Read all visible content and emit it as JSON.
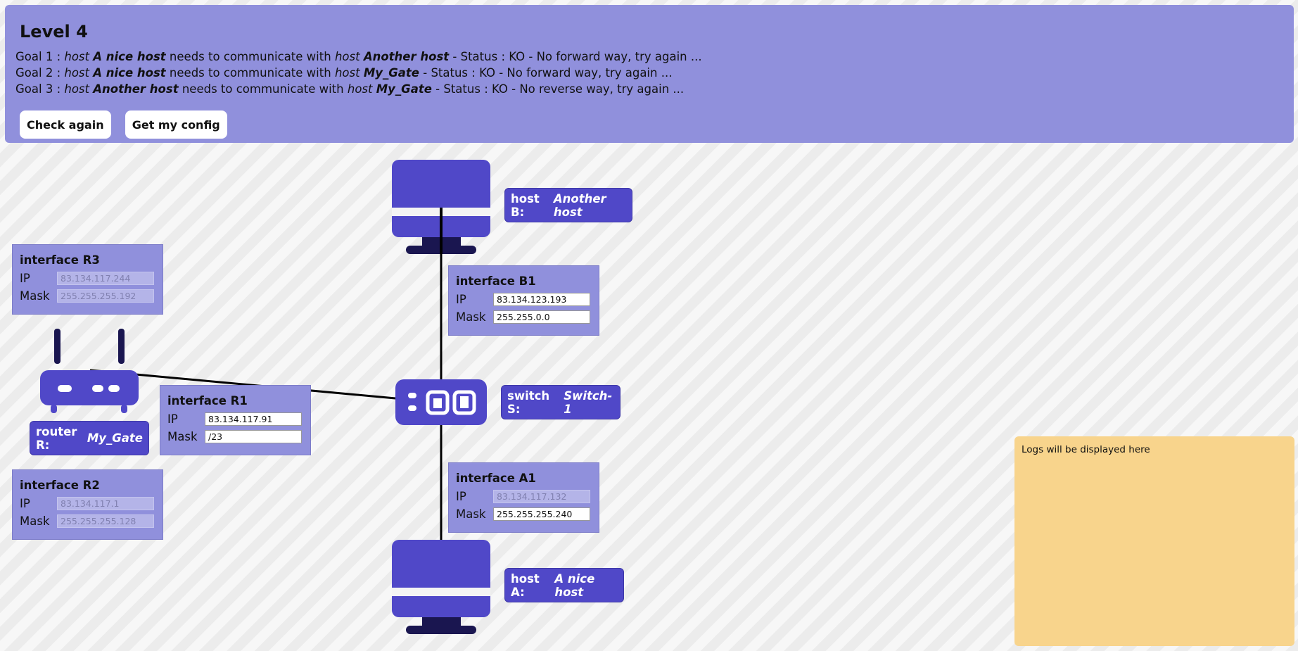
{
  "level": {
    "title": "Level 4"
  },
  "goals": [
    {
      "prefix": "Goal 1 : ",
      "src_kind": "host",
      "src_name": "A nice host",
      "mid": " needs to communicate with ",
      "dst_kind": "host",
      "dst_name": "Another host",
      "status": " - Status : KO - No forward way, try again ..."
    },
    {
      "prefix": "Goal 2 : ",
      "src_kind": "host",
      "src_name": "A nice host",
      "mid": " needs to communicate with ",
      "dst_kind": "host",
      "dst_name": "My_Gate",
      "status": " - Status : KO - No forward way, try again ..."
    },
    {
      "prefix": "Goal 3 : ",
      "src_kind": "host",
      "src_name": "Another host",
      "mid": " needs to communicate with ",
      "dst_kind": "host",
      "dst_name": "My_Gate",
      "status": " - Status : KO - No reverse way, try again ..."
    }
  ],
  "buttons": {
    "check": "Check again",
    "config": "Get my config"
  },
  "labels": {
    "host_b": {
      "prefix": "host B:",
      "name": "Another host"
    },
    "host_a": {
      "prefix": "host A:",
      "name": "A nice host"
    },
    "switch_s": {
      "prefix": "switch S:",
      "name": "Switch-1"
    },
    "router_r": {
      "prefix": "router R:",
      "name": "My_Gate"
    }
  },
  "interfaces": {
    "r3": {
      "title": "interface R3",
      "ip_label": "IP",
      "mask_label": "Mask",
      "ip": "83.134.117.244",
      "mask": "255.255.255.192"
    },
    "r1": {
      "title": "interface R1",
      "ip_label": "IP",
      "mask_label": "Mask",
      "ip": "83.134.117.91",
      "mask": "/23"
    },
    "r2": {
      "title": "interface R2",
      "ip_label": "IP",
      "mask_label": "Mask",
      "ip": "83.134.117.1",
      "mask": "255.255.255.128"
    },
    "b1": {
      "title": "interface B1",
      "ip_label": "IP",
      "mask_label": "Mask",
      "ip": "83.134.123.193",
      "mask": "255.255.0.0"
    },
    "a1": {
      "title": "interface A1",
      "ip_label": "IP",
      "mask_label": "Mask",
      "ip": "83.134.117.132",
      "mask": "255.255.255.240"
    }
  },
  "logs": {
    "text": "Logs will be displayed here"
  },
  "colors": {
    "panel": "#9090dc",
    "device": "#5048c8",
    "device_dark": "#1a1650",
    "logs_bg": "#f8d48c"
  },
  "icons": [
    "computer-icon",
    "switch-icon",
    "router-icon"
  ]
}
